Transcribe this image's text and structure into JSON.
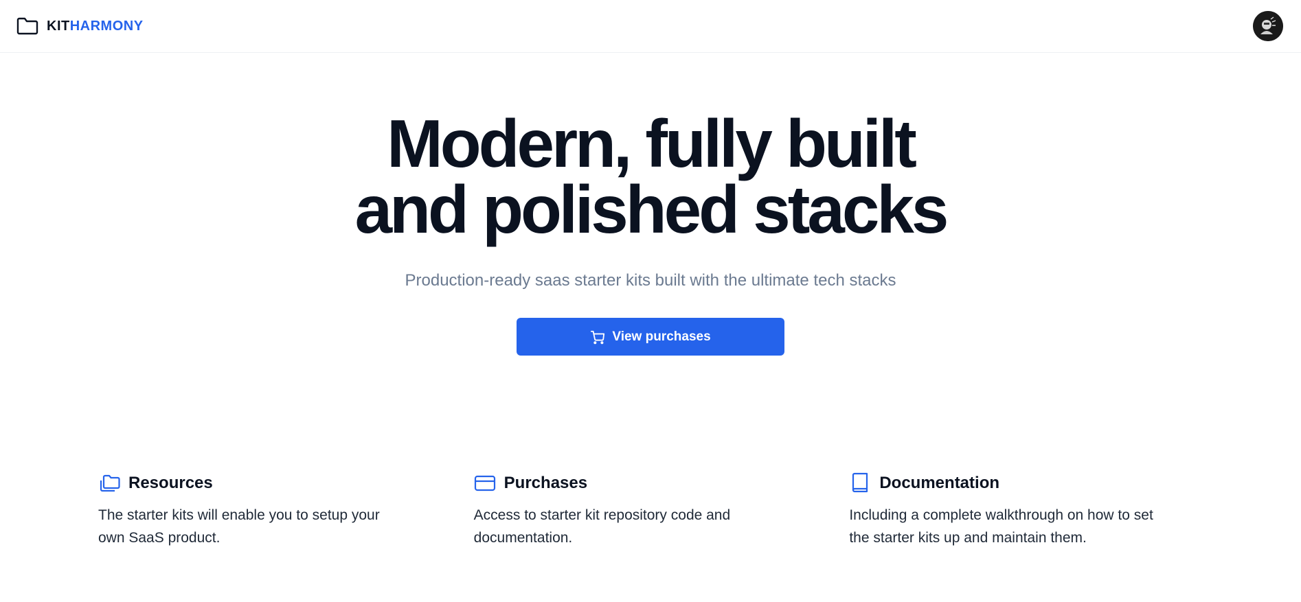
{
  "header": {
    "brand_part1": "KIT",
    "brand_part2": "HARMONY",
    "brand_icon": "folder-icon",
    "avatar_alt": "User avatar"
  },
  "hero": {
    "title_line1": "Modern, fully built",
    "title_line2": "and polished stacks",
    "subtitle": "Production-ready saas starter kits built with the ultimate tech stacks",
    "cta_label": "View purchases",
    "cta_icon": "cart-icon"
  },
  "features": [
    {
      "icon": "folders-icon",
      "title": "Resources",
      "description": "The starter kits will enable you to setup your own SaaS product."
    },
    {
      "icon": "credit-card-icon",
      "title": "Purchases",
      "description": "Access to starter kit repository code and documentation."
    },
    {
      "icon": "book-icon",
      "title": "Documentation",
      "description": "Including a complete walkthrough on how to set the starter kits up and maintain them."
    }
  ],
  "colors": {
    "accent": "#2563eb",
    "text_dark": "#0b1220",
    "text_muted": "#6b7a90"
  }
}
